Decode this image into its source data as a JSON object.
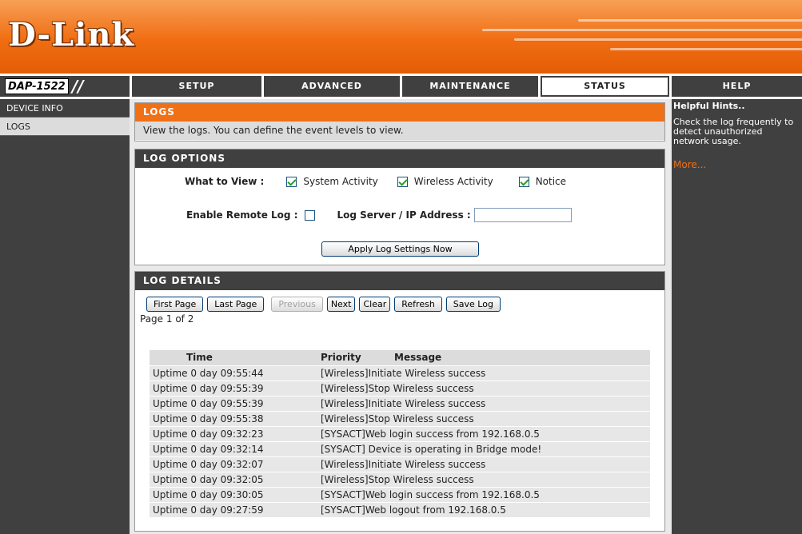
{
  "brand": {
    "logo": "D-Link",
    "model": "DAP-1522"
  },
  "tabs": [
    {
      "label": "SETUP"
    },
    {
      "label": "ADVANCED"
    },
    {
      "label": "MAINTENANCE"
    },
    {
      "label": "STATUS",
      "active": true
    },
    {
      "label": "HELP"
    }
  ],
  "sidebar": {
    "items": [
      {
        "label": "DEVICE INFO"
      },
      {
        "label": "LOGS",
        "active": true
      }
    ]
  },
  "logs_box": {
    "title": "LOGS",
    "description": "View the logs. You can define the event levels to view."
  },
  "log_options": {
    "title": "LOG OPTIONS",
    "what_to_view_label": "What to View :",
    "system_activity": {
      "label": "System Activity",
      "checked": true
    },
    "wireless_activity": {
      "label": "Wireless Activity",
      "checked": true
    },
    "notice": {
      "label": "Notice",
      "checked": true
    },
    "remote_log_label": "Enable Remote Log :",
    "remote_log_checked": false,
    "server_label": "Log Server / IP Address :",
    "server_value": "",
    "apply_button": "Apply Log Settings Now"
  },
  "log_details": {
    "title": "LOG DETAILS",
    "buttons": {
      "first": "First Page",
      "last": "Last Page",
      "previous": "Previous",
      "next": "Next",
      "clear": "Clear",
      "refresh": "Refresh",
      "save": "Save Log"
    },
    "page_info": "Page 1 of 2",
    "columns": {
      "time": "Time",
      "priority": "Priority",
      "message": "Message"
    },
    "rows": [
      {
        "time": "Uptime 0 day 09:55:44",
        "message": "[Wireless]Initiate Wireless success"
      },
      {
        "time": "Uptime 0 day 09:55:39",
        "message": "[Wireless]Stop Wireless success"
      },
      {
        "time": "Uptime 0 day 09:55:39",
        "message": "[Wireless]Initiate Wireless success"
      },
      {
        "time": "Uptime 0 day 09:55:38",
        "message": "[Wireless]Stop Wireless success"
      },
      {
        "time": "Uptime 0 day 09:32:23",
        "message": "[SYSACT]Web login success from 192.168.0.5"
      },
      {
        "time": "Uptime 0 day 09:32:14",
        "message": "[SYSACT] Device is operating in Bridge mode!"
      },
      {
        "time": "Uptime 0 day 09:32:07",
        "message": "[Wireless]Initiate Wireless success"
      },
      {
        "time": "Uptime 0 day 09:32:05",
        "message": "[Wireless]Stop Wireless success"
      },
      {
        "time": "Uptime 0 day 09:30:05",
        "message": "[SYSACT]Web login success from 192.168.0.5"
      },
      {
        "time": "Uptime 0 day 09:27:59",
        "message": "[SYSACT]Web logout from 192.168.0.5"
      }
    ]
  },
  "help": {
    "title": "Helpful Hints..",
    "text": "Check the log frequently to detect unauthorized network usage.",
    "more": "More..."
  },
  "colors": {
    "accent": "#f07015",
    "dark": "#404040",
    "light": "#dcdcdc"
  }
}
